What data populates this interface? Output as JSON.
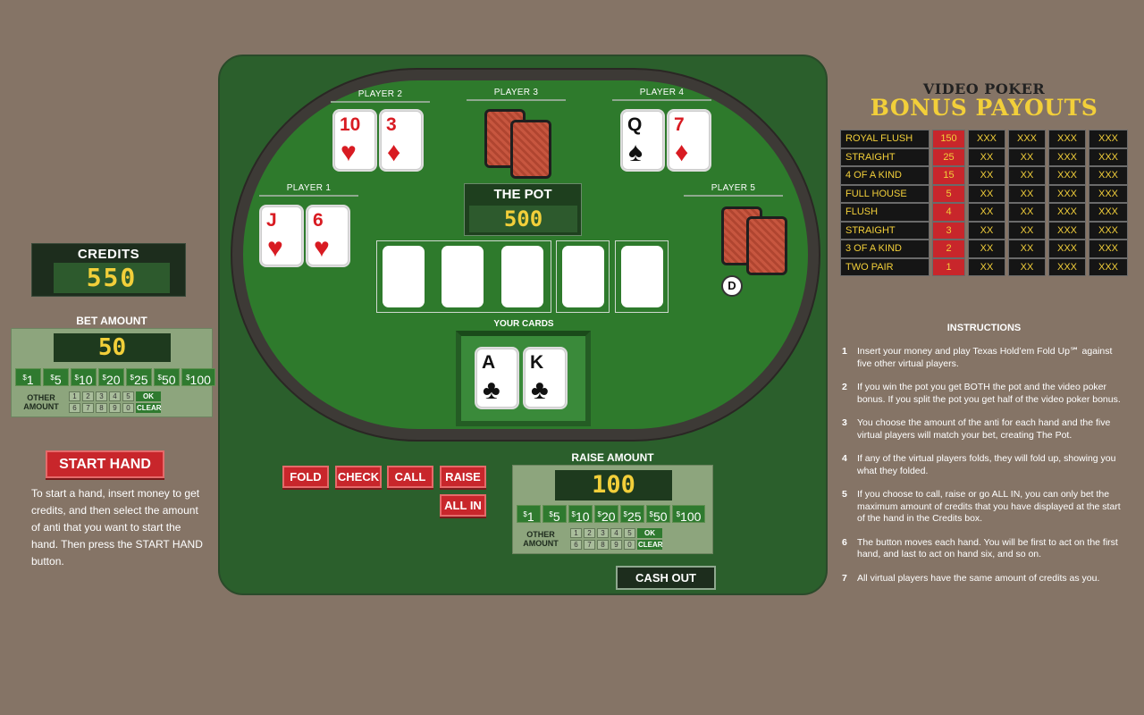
{
  "credits": {
    "title": "CREDITS",
    "value": "550"
  },
  "bet": {
    "title": "BET AMOUNT",
    "value": "50",
    "chips": [
      {
        "cur": "$",
        "amt": "1"
      },
      {
        "cur": "$",
        "amt": "5"
      },
      {
        "cur": "$",
        "amt": "10"
      },
      {
        "cur": "$",
        "amt": "20"
      },
      {
        "cur": "$",
        "amt": "25"
      },
      {
        "cur": "$",
        "amt": "50"
      },
      {
        "cur": "$",
        "amt": "100"
      }
    ],
    "other_label_1": "OTHER",
    "other_label_2": "AMOUNT",
    "keys": [
      "1",
      "2",
      "3",
      "4",
      "5",
      "OK",
      "6",
      "7",
      "8",
      "9",
      "0",
      "CLEAR"
    ]
  },
  "start_hand": {
    "label": "START HAND",
    "help": "To start a hand, insert money to get credits, and then select the amount of anti that you want to start the hand. Then press the START HAND button."
  },
  "players": [
    {
      "label": "PLAYER 1",
      "cards": [
        {
          "rank": "J",
          "suit": "♥"
        },
        {
          "rank": "6",
          "suit": "♥"
        }
      ]
    },
    {
      "label": "PLAYER 2",
      "cards": [
        {
          "rank": "10",
          "suit": "♥"
        },
        {
          "rank": "3",
          "suit": "♦"
        }
      ]
    },
    {
      "label": "PLAYER 3"
    },
    {
      "label": "PLAYER 4",
      "cards": [
        {
          "rank": "Q",
          "suit": "♠"
        },
        {
          "rank": "7",
          "suit": "♦"
        }
      ]
    },
    {
      "label": "PLAYER 5"
    }
  ],
  "pot": {
    "title": "THE POT",
    "value": "500"
  },
  "dealer_button": "D",
  "your_cards": {
    "label": "YOUR CARDS",
    "cards": [
      {
        "rank": "A",
        "suit": "♣"
      },
      {
        "rank": "K",
        "suit": "♣"
      }
    ]
  },
  "actions": {
    "fold": "FOLD",
    "check": "CHECK",
    "call": "CALL",
    "raise": "RAISE",
    "all_in": "ALL IN"
  },
  "raise": {
    "title": "RAISE AMOUNT",
    "value": "100",
    "chips": [
      {
        "cur": "$",
        "amt": "1"
      },
      {
        "cur": "$",
        "amt": "5"
      },
      {
        "cur": "$",
        "amt": "10"
      },
      {
        "cur": "$",
        "amt": "20"
      },
      {
        "cur": "$",
        "amt": "25"
      },
      {
        "cur": "$",
        "amt": "50"
      },
      {
        "cur": "$",
        "amt": "100"
      }
    ],
    "other_label_1": "OTHER",
    "other_label_2": "AMOUNT",
    "keys": [
      "1",
      "2",
      "3",
      "4",
      "5",
      "OK",
      "6",
      "7",
      "8",
      "9",
      "0",
      "CLEAR"
    ]
  },
  "cash_out": "CASH OUT",
  "bonus": {
    "subtitle": "VIDEO POKER",
    "title": "BONUS PAYOUTS",
    "rows": [
      {
        "hand": "ROYAL FLUSH",
        "pay": "150",
        "c1": "XXX",
        "c2": "XXX",
        "c3": "XXX",
        "c4": "XXX"
      },
      {
        "hand": "STRAIGHT FLUSH",
        "pay": "25",
        "c1": "XX",
        "c2": "XX",
        "c3": "XXX",
        "c4": "XXX"
      },
      {
        "hand": "4 OF A KIND",
        "pay": "15",
        "c1": "XX",
        "c2": "XX",
        "c3": "XXX",
        "c4": "XXX"
      },
      {
        "hand": "FULL HOUSE",
        "pay": "5",
        "c1": "XX",
        "c2": "XX",
        "c3": "XXX",
        "c4": "XXX"
      },
      {
        "hand": "FLUSH",
        "pay": "4",
        "c1": "XX",
        "c2": "XX",
        "c3": "XXX",
        "c4": "XXX"
      },
      {
        "hand": "STRAIGHT",
        "pay": "3",
        "c1": "XX",
        "c2": "XX",
        "c3": "XXX",
        "c4": "XXX"
      },
      {
        "hand": "3 OF A KIND",
        "pay": "2",
        "c1": "XX",
        "c2": "XX",
        "c3": "XXX",
        "c4": "XXX"
      },
      {
        "hand": "TWO PAIR",
        "pay": "1",
        "c1": "XX",
        "c2": "XX",
        "c3": "XXX",
        "c4": "XXX"
      }
    ]
  },
  "instructions": {
    "title": "INSTRUCTIONS",
    "items": [
      {
        "num": "1",
        "text": "Insert your money and play Texas Hold’em Fold Up℠ against five other virtual players."
      },
      {
        "num": "2",
        "text": "If you win the pot you get BOTH the pot and the video poker bonus. If you split the pot you get half of the video poker bonus."
      },
      {
        "num": "3",
        "text": "You choose the amount of the anti for each hand and the five virtual players will match your bet, creating The Pot."
      },
      {
        "num": "4",
        "text": "If any of the virtual players folds, they will fold up, showing you what they folded."
      },
      {
        "num": "5",
        "text": "If you choose to call, raise or go ALL IN, you can only bet the maximum amount of credits that you have displayed at the start of the hand in the Credits box."
      },
      {
        "num": "6",
        "text": "The button moves each hand. You will be first to act on the first hand, and last to act on hand six, and so on."
      },
      {
        "num": "7",
        "text": "All virtual players have the same amount of credits as you."
      }
    ]
  }
}
